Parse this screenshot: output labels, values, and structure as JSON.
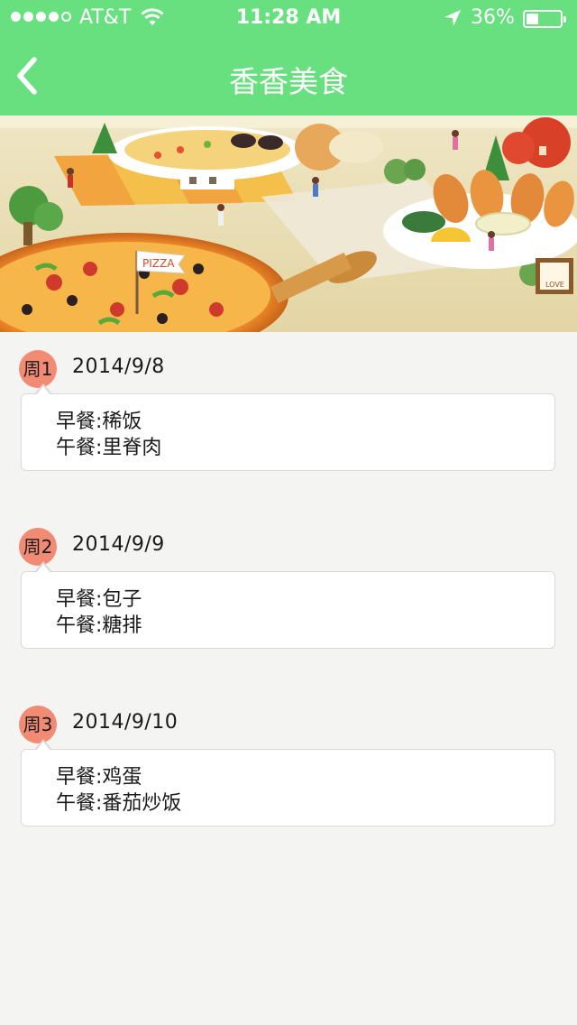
{
  "status_bar": {
    "carrier": "AT&T",
    "time": "11:28 AM",
    "battery": "36%",
    "battery_level": 0.36
  },
  "nav": {
    "title": "香香美食"
  },
  "banner": {
    "pizza_flag_text": "PIZZA",
    "love_sign_text": "LOVE"
  },
  "meals": [
    {
      "day": "周1",
      "date": "2014/9/8",
      "breakfast": "早餐:稀饭",
      "lunch": "午餐:里脊肉"
    },
    {
      "day": "周2",
      "date": "2014/9/9",
      "breakfast": "早餐:包子",
      "lunch": "午餐:糖排"
    },
    {
      "day": "周3",
      "date": "2014/9/10",
      "breakfast": "早餐:鸡蛋",
      "lunch": "午餐:番茄炒饭"
    }
  ],
  "colors": {
    "header_green": "#68e07f",
    "badge_salmon": "#f28b73",
    "background": "#f4f4f2"
  }
}
